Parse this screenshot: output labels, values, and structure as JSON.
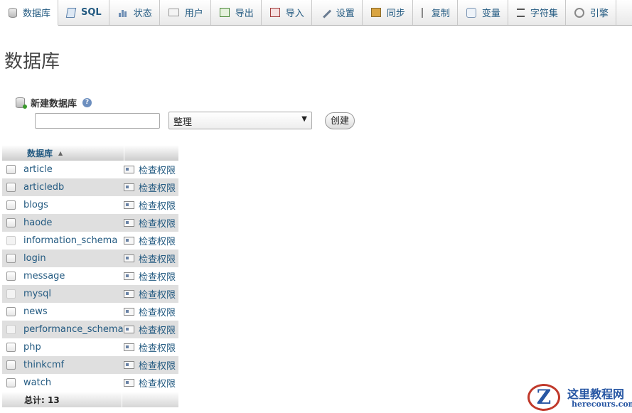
{
  "tabs": [
    {
      "label": "数据库",
      "icon": "database-icon",
      "active": true
    },
    {
      "label": "SQL",
      "icon": "sql-icon"
    },
    {
      "label": "状态",
      "icon": "status-chart-icon"
    },
    {
      "label": "用户",
      "icon": "users-icon"
    },
    {
      "label": "导出",
      "icon": "export-icon"
    },
    {
      "label": "导入",
      "icon": "import-icon"
    },
    {
      "label": "设置",
      "icon": "wrench-icon"
    },
    {
      "label": "同步",
      "icon": "sync-icon"
    },
    {
      "label": "复制",
      "icon": "replication-icon"
    },
    {
      "label": "变量",
      "icon": "variables-icon"
    },
    {
      "label": "字符集",
      "icon": "charset-icon"
    },
    {
      "label": "引擎",
      "icon": "engine-icon"
    }
  ],
  "page": {
    "title": "数据库"
  },
  "create_db": {
    "label": "新建数据库",
    "help_icon": "?",
    "name_value": "",
    "collation_value": "整理",
    "create_label": "创建"
  },
  "table": {
    "header": "数据库",
    "privilege_label": "检查权限",
    "rows": [
      {
        "name": "article",
        "disabled": false
      },
      {
        "name": "articledb",
        "disabled": false
      },
      {
        "name": "blogs",
        "disabled": false
      },
      {
        "name": "haode",
        "disabled": false
      },
      {
        "name": "information_schema",
        "disabled": true
      },
      {
        "name": "login",
        "disabled": false
      },
      {
        "name": "message",
        "disabled": false
      },
      {
        "name": "mysql",
        "disabled": true
      },
      {
        "name": "news",
        "disabled": false
      },
      {
        "name": "performance_schema",
        "disabled": true
      },
      {
        "name": "php",
        "disabled": false
      },
      {
        "name": "thinkcmf",
        "disabled": false
      },
      {
        "name": "watch",
        "disabled": false
      }
    ],
    "total_label": "总计: 13"
  },
  "watermark": {
    "logo_letter": "Z",
    "title": "这里教程网",
    "url": "herecours.com"
  }
}
